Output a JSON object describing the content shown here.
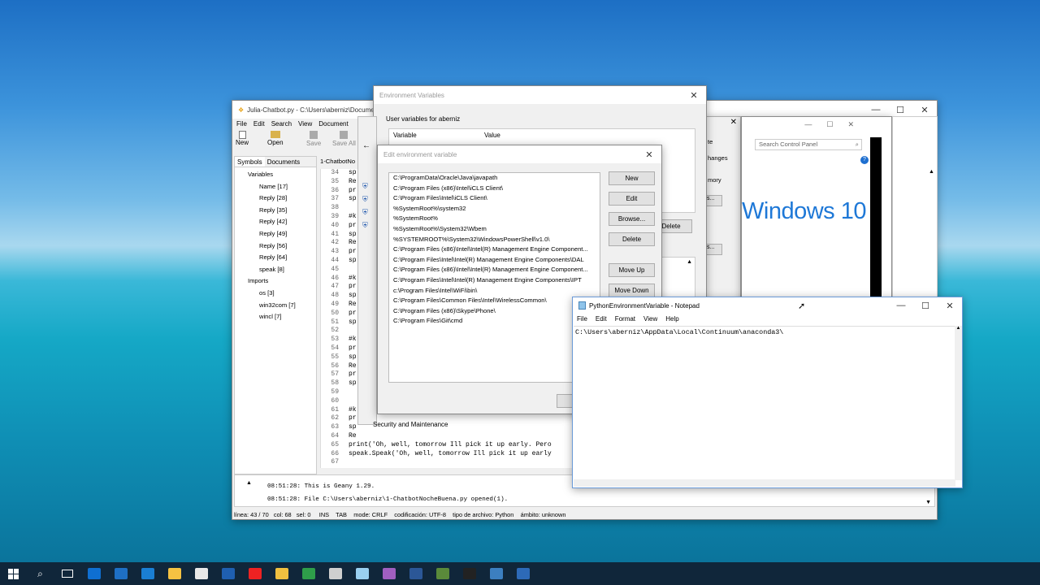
{
  "geany": {
    "title": "Julia-Chatbot.py - C:\\Users\\aberniz\\Documents",
    "menu": [
      "File",
      "Edit",
      "Search",
      "View",
      "Document"
    ],
    "toolbar": [
      "New",
      "Open",
      "Save",
      "Save All"
    ],
    "side_tabs": [
      "Symbols",
      "Documents"
    ],
    "file_tab": "1-ChatbotNo",
    "tree": [
      {
        "label": "Variables",
        "indent": 0
      },
      {
        "label": "Name [17]",
        "indent": 1
      },
      {
        "label": "Reply [28]",
        "indent": 1
      },
      {
        "label": "Reply [35]",
        "indent": 1
      },
      {
        "label": "Reply [42]",
        "indent": 1
      },
      {
        "label": "Reply [49]",
        "indent": 1
      },
      {
        "label": "Reply [56]",
        "indent": 1
      },
      {
        "label": "Reply [64]",
        "indent": 1
      },
      {
        "label": "speak [8]",
        "indent": 1
      },
      {
        "label": "Imports",
        "indent": 0
      },
      {
        "label": "os [3]",
        "indent": 1
      },
      {
        "label": "win32com [7]",
        "indent": 1
      },
      {
        "label": "wincl [7]",
        "indent": 1
      }
    ],
    "code": [
      [
        "34",
        "sp"
      ],
      [
        "35",
        "Re"
      ],
      [
        "36",
        "pr"
      ],
      [
        "37",
        "sp"
      ],
      [
        "38",
        ""
      ],
      [
        "39",
        "#k"
      ],
      [
        "40",
        "pr"
      ],
      [
        "41",
        "sp"
      ],
      [
        "42",
        "Re"
      ],
      [
        "43",
        "pr"
      ],
      [
        "44",
        "sp"
      ],
      [
        "45",
        ""
      ],
      [
        "46",
        "#k"
      ],
      [
        "47",
        "pr"
      ],
      [
        "48",
        "sp"
      ],
      [
        "49",
        "Re"
      ],
      [
        "50",
        "pr"
      ],
      [
        "51",
        "sp"
      ],
      [
        "52",
        ""
      ],
      [
        "53",
        "#k"
      ],
      [
        "54",
        "pr"
      ],
      [
        "55",
        "sp"
      ],
      [
        "56",
        "Re"
      ],
      [
        "57",
        "pr"
      ],
      [
        "58",
        "sp"
      ],
      [
        "59",
        ""
      ],
      [
        "60",
        ""
      ],
      [
        "61",
        "#k"
      ],
      [
        "62",
        "pr"
      ],
      [
        "63",
        "sp"
      ],
      [
        "64",
        "Re"
      ],
      [
        "65",
        "print('Oh, well, tomorrow Ill pick it up early. Pero"
      ],
      [
        "66",
        "speak.Speak('Oh, well, tomorrow Ill pick it up early"
      ],
      [
        "67",
        ""
      ]
    ],
    "messages": [
      "08:51:28: This is Geany 1.29.",
      "08:51:28: File C:\\Users\\aberniz\\1-ChatbotNocheBuena.py opened(1)."
    ],
    "status": "línea: 43 / 70   col: 68   sel: 0     INS    TAB    mode: CRLF    codificación: UTF-8    tipo de archivo: Python    ámbito: unknown"
  },
  "env": {
    "title": "Environment Variables",
    "user_label": "User variables for aberniz",
    "col_variable": "Variable",
    "col_value": "Value"
  },
  "edit": {
    "title": "Edit environment variable",
    "paths": [
      "C:\\ProgramData\\Oracle\\Java\\javapath",
      "C:\\Program Files (x86)\\Intel\\iCLS Client\\",
      "C:\\Program Files\\Intel\\iCLS Client\\",
      "%SystemRoot%\\system32",
      "%SystemRoot%",
      "%SystemRoot%\\System32\\Wbem",
      "%SYSTEMROOT%\\System32\\WindowsPowerShell\\v1.0\\",
      "C:\\Program Files (x86)\\Intel\\Intel(R) Management Engine Component...",
      "C:\\Program Files\\Intel\\Intel(R) Management Engine Components\\DAL",
      "C:\\Program Files (x86)\\Intel\\Intel(R) Management Engine Component...",
      "C:\\Program Files\\Intel\\Intel(R) Management Engine Components\\IPT",
      "c:\\Program Files\\Intel\\WiFi\\bin\\",
      "C:\\Program Files\\Common Files\\Intel\\WirelessCommon\\",
      "C:\\Program Files (x86)\\Skype\\Phone\\",
      "C:\\Program Files\\Git\\cmd"
    ],
    "buttons": {
      "new": "New",
      "edit": "Edit",
      "browse": "Browse...",
      "delete": "Delete",
      "move_up": "Move Up",
      "move_down": "Move Down"
    }
  },
  "sysbehind": {
    "delete_label": "Delete",
    "frag_te": "te",
    "frag_hanges": "hanges",
    "frag_mory": "mory",
    "security": "Security and Maintenance",
    "dots": "s..."
  },
  "control": {
    "search_placeholder": "Search Control Panel",
    "windows10": "Windows 10"
  },
  "notepad": {
    "title": "PythonEnvironmentVariable - Notepad",
    "menu": [
      "File",
      "Edit",
      "Format",
      "View",
      "Help"
    ],
    "content": "C:\\Users\\aberniz\\AppData\\Local\\Continuum\\anaconda3\\"
  },
  "taskbar": {
    "colors": [
      "#0f6fd1",
      "#1e6fc4",
      "#1a7fd4",
      "#f5c242",
      "#e8e8e8",
      "#1f5fb0",
      "#e22",
      "#f0c040",
      "#2e9e4a",
      "#cfcfcf",
      "#9ad0f0",
      "#a05fc0",
      "#2b5797",
      "#5a8a3a",
      "#222",
      "#3c7fc0",
      "#2d6ab8"
    ]
  }
}
